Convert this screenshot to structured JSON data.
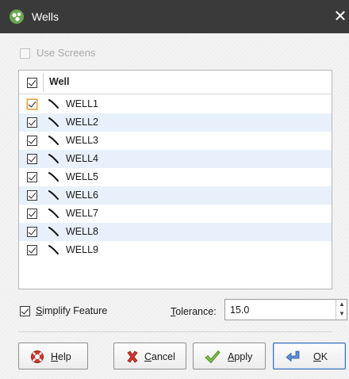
{
  "window": {
    "title": "Wells",
    "close_glyph": "✕"
  },
  "use_screens": {
    "label": "Use Screens",
    "checked": false,
    "enabled": false
  },
  "table": {
    "column_header": "Well",
    "header_checked": true,
    "rows": [
      {
        "name": "WELL1",
        "checked": true,
        "focused": true
      },
      {
        "name": "WELL2",
        "checked": true
      },
      {
        "name": "WELL3",
        "checked": true
      },
      {
        "name": "WELL4",
        "checked": true
      },
      {
        "name": "WELL5",
        "checked": true
      },
      {
        "name": "WELL6",
        "checked": true
      },
      {
        "name": "WELL7",
        "checked": true
      },
      {
        "name": "WELL8",
        "checked": true
      },
      {
        "name": "WELL9",
        "checked": true
      }
    ]
  },
  "simplify": {
    "label_mnemonic": "S",
    "label_rest": "implify Feature",
    "checked": true
  },
  "tolerance": {
    "label_mnemonic": "T",
    "label_rest": "olerance:",
    "value": "15.0"
  },
  "buttons": {
    "help": {
      "mnemonic": "H",
      "rest": "elp"
    },
    "cancel": {
      "mnemonic": "C",
      "rest": "ancel"
    },
    "apply": {
      "mnemonic": "A",
      "rest": "pply"
    },
    "ok": {
      "mnemonic": "O",
      "rest": "K"
    }
  },
  "icons": {
    "app": "geo-app-icon",
    "well": "well-trace-icon",
    "help": "lifebuoy-icon",
    "cancel": "red-x-icon",
    "apply": "green-check-icon",
    "ok": "enter-arrow-icon"
  },
  "colors": {
    "titlebar": "#3a3a3a",
    "row_alt": "#e8f1fb",
    "focus": "#e89a2b",
    "ok_border": "#3c6fb5"
  }
}
